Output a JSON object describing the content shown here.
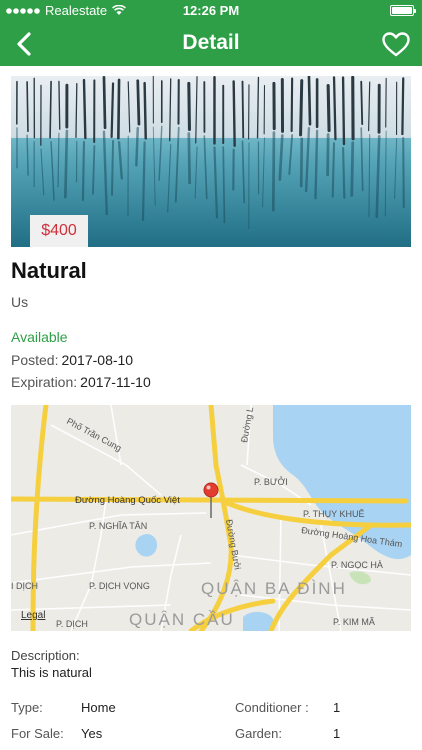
{
  "status_bar": {
    "carrier": "Realestate",
    "time": "12:26 PM",
    "battery_level": 1.0
  },
  "nav": {
    "title": "Detail",
    "back_icon": "chevron-left-icon",
    "favorite_icon": "heart-outline-icon"
  },
  "listing": {
    "price": "$400",
    "title": "Natural",
    "location": "Us",
    "status": "Available",
    "posted_label": "Posted:",
    "posted_value": "2017-08-10",
    "expiration_label": "Expiration:",
    "expiration_value": "2017-11-10"
  },
  "map": {
    "legal": "Legal",
    "labels": {
      "street_hoang_quoc_viet": "Đường Hoàng Quốc Việt",
      "street_hoang_hoa_tham": "Đường Hoàng Hoa Thám",
      "street_buoi": "Đường Bưởi",
      "street_pho_tran_cung": "Phố Trần Cung",
      "ward_buoi": "P. BƯỞI",
      "ward_thuy_khue": "P. THỤY KHUÊ",
      "ward_nghia_tan": "P. NGHĨA TÂN",
      "ward_ngoc_ha": "P. NGỌC HÀ",
      "ward_dich_vong": "P. DỊCH VỌNG",
      "ward_dich_left": "I DỊCH",
      "ward_dich_bottom": "P. DỊCH",
      "ward_kim_ma": "P. KIM MÃ",
      "district_ba_dinh": "QUẬN BA ĐÌNH",
      "district_cau": "QUẬN CẦU",
      "street_l_partial": "Đường L"
    },
    "colors": {
      "land": "#ecebe6",
      "water": "#a9d3f2",
      "major_road": "#f6cf3f",
      "minor_road": "#ffffff",
      "pin": "#e23b2f",
      "park": "#c9e3b8"
    }
  },
  "description": {
    "label": "Description:",
    "text": "This is natural"
  },
  "attributes": {
    "type_label": "Type:",
    "type_value": "Home",
    "for_sale_label": "For Sale:",
    "for_sale_value": "Yes",
    "conditioner_label": "Conditioner :",
    "conditioner_value": "1",
    "garden_label": "Garden:",
    "garden_value": "1"
  },
  "colors": {
    "brand_green": "#2e9e47",
    "price_red": "#d0303a"
  }
}
